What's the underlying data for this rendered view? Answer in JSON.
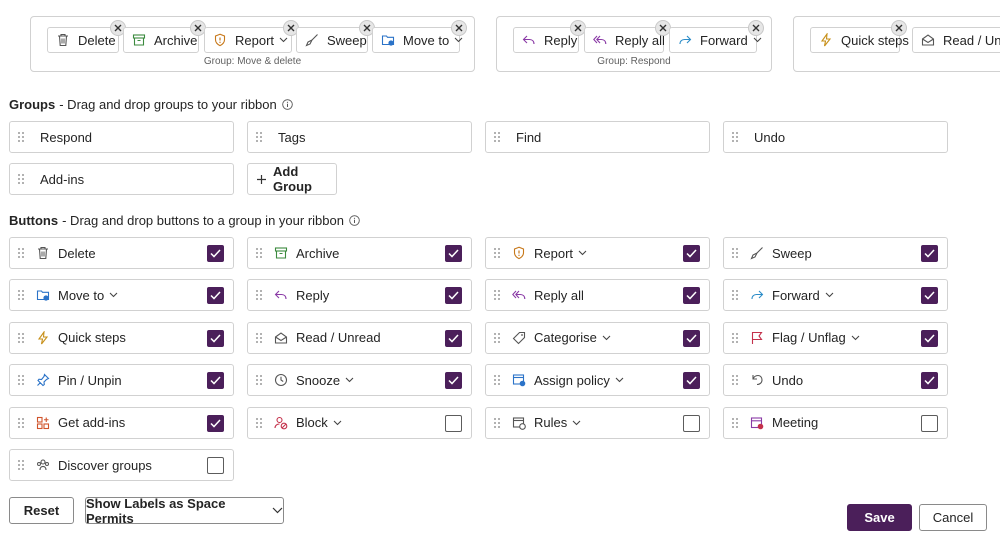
{
  "ribbon": {
    "groups": [
      {
        "caption": "Group: Move & delete",
        "buttons": [
          {
            "label": "Delete",
            "icon": "trash-icon"
          },
          {
            "label": "Archive",
            "icon": "archive-icon"
          },
          {
            "label": "Report",
            "icon": "shield-icon",
            "dropdown": true
          },
          {
            "label": "Sweep",
            "icon": "broom-icon"
          },
          {
            "label": "Move to",
            "icon": "folder-move-icon",
            "dropdown": true
          }
        ]
      },
      {
        "caption": "Group: Respond",
        "buttons": [
          {
            "label": "Reply",
            "icon": "reply-icon"
          },
          {
            "label": "Reply all",
            "icon": "reply-all-icon"
          },
          {
            "label": "Forward",
            "icon": "forward-icon",
            "dropdown": true
          }
        ]
      },
      {
        "caption": "",
        "buttons": [
          {
            "label": "Quick steps",
            "icon": "lightning-icon"
          },
          {
            "label": "Read / Un",
            "icon": "envelope-open-icon"
          }
        ]
      }
    ]
  },
  "groups_section": {
    "title": "Groups",
    "subtitle": "- Drag and drop groups to your ribbon",
    "items": [
      "Respond",
      "Tags",
      "Find",
      "Undo",
      "Add-ins"
    ],
    "add_group_label": "Add Group"
  },
  "buttons_section": {
    "title": "Buttons",
    "subtitle": "- Drag and drop buttons to a group in your ribbon",
    "items": [
      {
        "label": "Delete",
        "icon": "trash-icon",
        "checked": true
      },
      {
        "label": "Archive",
        "icon": "archive-icon",
        "checked": true
      },
      {
        "label": "Report",
        "icon": "shield-icon",
        "dropdown": true,
        "checked": true
      },
      {
        "label": "Sweep",
        "icon": "broom-icon",
        "checked": true
      },
      {
        "label": "Move to",
        "icon": "folder-move-icon",
        "dropdown": true,
        "checked": true
      },
      {
        "label": "Reply",
        "icon": "reply-icon",
        "checked": true
      },
      {
        "label": "Reply all",
        "icon": "reply-all-icon",
        "checked": true
      },
      {
        "label": "Forward",
        "icon": "forward-icon",
        "dropdown": true,
        "checked": true
      },
      {
        "label": "Quick steps",
        "icon": "lightning-icon",
        "checked": true
      },
      {
        "label": "Read / Unread",
        "icon": "envelope-open-icon",
        "checked": true
      },
      {
        "label": "Categorise",
        "icon": "tag-icon",
        "dropdown": true,
        "checked": true
      },
      {
        "label": "Flag / Unflag",
        "icon": "flag-icon",
        "dropdown": true,
        "checked": true
      },
      {
        "label": "Pin / Unpin",
        "icon": "pin-icon",
        "checked": true
      },
      {
        "label": "Snooze",
        "icon": "clock-icon",
        "dropdown": true,
        "checked": true
      },
      {
        "label": "Assign policy",
        "icon": "policy-icon",
        "dropdown": true,
        "checked": true
      },
      {
        "label": "Undo",
        "icon": "undo-icon",
        "checked": true
      },
      {
        "label": "Get add-ins",
        "icon": "grid-plus-icon",
        "checked": true
      },
      {
        "label": "Block",
        "icon": "block-person-icon",
        "dropdown": true,
        "checked": false
      },
      {
        "label": "Rules",
        "icon": "rules-icon",
        "dropdown": true,
        "checked": false
      },
      {
        "label": "Meeting",
        "icon": "calendar-icon",
        "checked": false
      },
      {
        "label": "Discover groups",
        "icon": "people-icon",
        "checked": false
      }
    ]
  },
  "footer": {
    "reset_label": "Reset",
    "labels_dropdown_label": "Show Labels as Space Permits",
    "save_label": "Save",
    "cancel_label": "Cancel"
  },
  "colors": {
    "accent": "#4b1f5a",
    "border": "#d1d1d1",
    "archive_green": "#3b8a3e",
    "report_orange": "#c7781a",
    "folder_blue": "#2b73c8",
    "reply_purple": "#8a3aa6",
    "forward_teal": "#2b8cc8",
    "flag_red": "#c4314b"
  }
}
